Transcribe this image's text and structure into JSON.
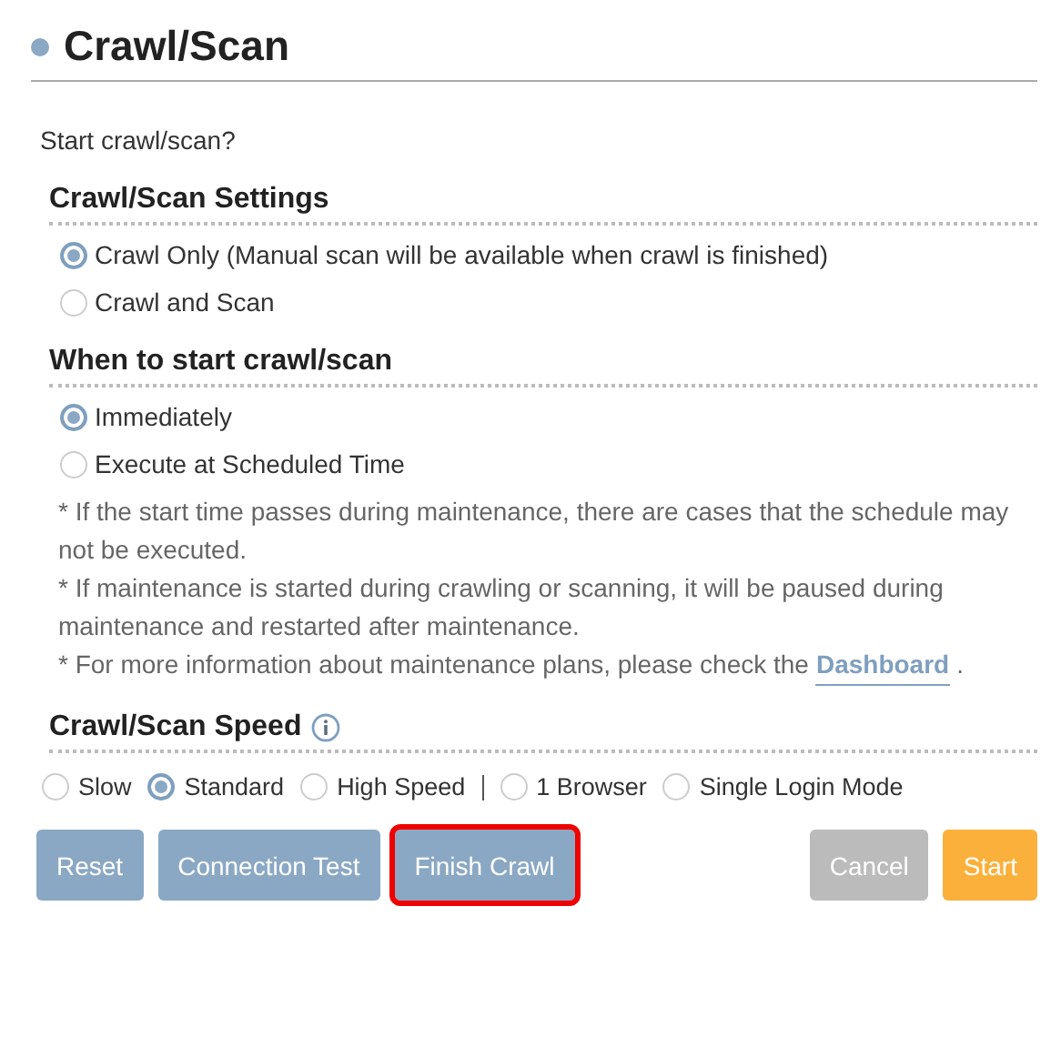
{
  "title": "Crawl/Scan",
  "prompt": "Start crawl/scan?",
  "settings": {
    "heading": "Crawl/Scan Settings",
    "options": [
      {
        "label": "Crawl Only (Manual scan will be available when crawl is finished)",
        "selected": true
      },
      {
        "label": "Crawl and Scan",
        "selected": false
      }
    ]
  },
  "timing": {
    "heading": "When to start crawl/scan",
    "options": [
      {
        "label": "Immediately",
        "selected": true
      },
      {
        "label": "Execute at Scheduled Time",
        "selected": false
      }
    ],
    "notes": [
      {
        "text": "* If the start time passes during maintenance, there are cases that the schedule may not be executed."
      },
      {
        "text": "* If maintenance is started during crawling or scanning, it will be paused during maintenance and restarted after maintenance."
      },
      {
        "text": "* For more information about maintenance plans, please check the",
        "link": "Dashboard",
        "suffix": "."
      }
    ]
  },
  "speed": {
    "heading": "Crawl/Scan Speed",
    "info_icon": true,
    "options": [
      {
        "label": "Slow",
        "selected": false
      },
      {
        "label": "Standard",
        "selected": true
      },
      {
        "label": "High Speed",
        "selected": false
      }
    ],
    "modes": [
      {
        "label": "1 Browser",
        "checked": false
      },
      {
        "label": "Single Login Mode",
        "checked": false
      }
    ]
  },
  "buttons_left": [
    {
      "label": "Reset",
      "kind": "secondary",
      "highlighted": false
    },
    {
      "label": "Connection Test",
      "kind": "secondary",
      "highlighted": false
    },
    {
      "label": "Finish Crawl",
      "kind": "secondary",
      "highlighted": true
    }
  ],
  "buttons_right": [
    {
      "label": "Cancel",
      "kind": "muted",
      "highlighted": false
    },
    {
      "label": "Start",
      "kind": "accent",
      "highlighted": false
    }
  ]
}
